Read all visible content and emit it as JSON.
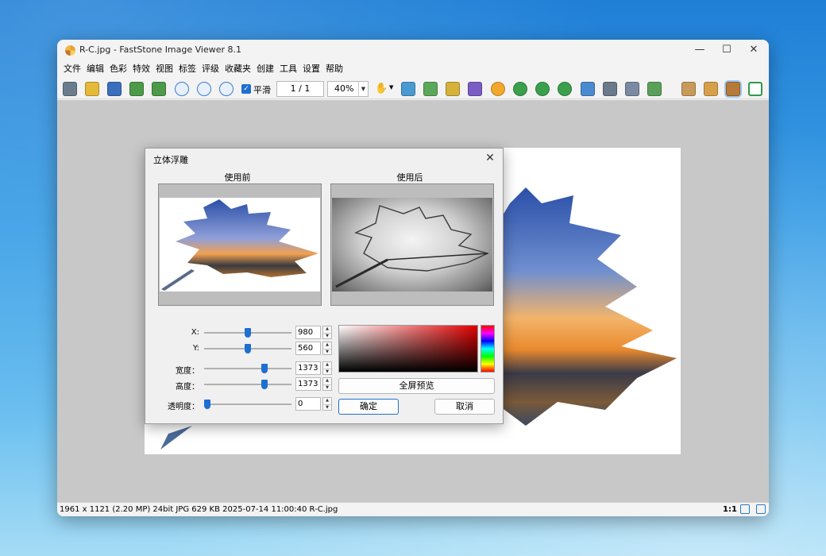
{
  "window": {
    "title": "R-C.jpg  -  FastStone Image Viewer 8.1",
    "controls": {
      "minimize": "—",
      "maximize": "☐",
      "close": "✕"
    }
  },
  "menu": [
    "文件",
    "编辑",
    "色彩",
    "特效",
    "视图",
    "标签",
    "评级",
    "收藏夹",
    "创建",
    "工具",
    "设置",
    "帮助"
  ],
  "toolbar": {
    "smooth_label": "平滑",
    "smooth_checked": true,
    "page": "1 / 1",
    "zoom": "40%",
    "hand_icon": "✋",
    "colors": {
      "camera": "#6b7d8c",
      "open": "#e5b93a",
      "save": "#3a6fbd",
      "prev": "#4c9a4a",
      "next": "#4c9a4a",
      "zoom": "#3a7bd0",
      "accent": "#1e6fd0"
    }
  },
  "dialog": {
    "title": "立体浮雕",
    "before_label": "使用前",
    "after_label": "使用后",
    "params": [
      {
        "label": "X:",
        "value": "980",
        "level": 0.5
      },
      {
        "label": "Y:",
        "value": "560",
        "level": 0.5
      },
      {
        "label": "宽度：",
        "value": "1373",
        "level": 0.68
      },
      {
        "label": "高度：",
        "value": "1373",
        "level": 0.68
      },
      {
        "label": "透明度：",
        "value": "0",
        "level": 0.0
      }
    ],
    "fullscreen_btn": "全屏预览",
    "ok_btn": "确定",
    "cancel_btn": "取消"
  },
  "status": {
    "info": "1961 x 1121 (2.20 MP)  24bit  JPG   629 KB    2025-07-14 11:00:40    R-C.jpg",
    "ratio": "1:1"
  }
}
